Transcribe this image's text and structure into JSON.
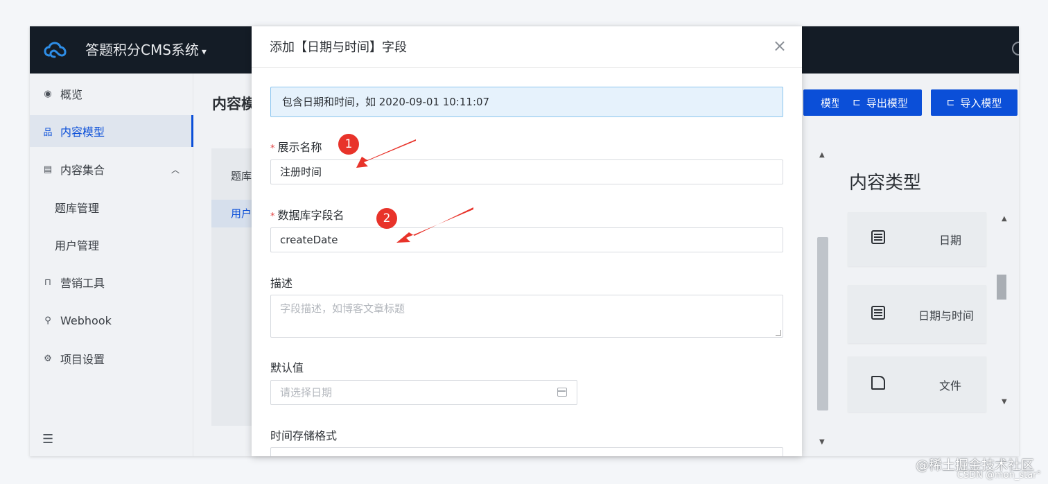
{
  "app": {
    "title": "答题积分CMS系统",
    "caret": "▾"
  },
  "sidebar": {
    "items": [
      {
        "label": "概览",
        "icon": "eye-icon",
        "glyph": "◉"
      },
      {
        "label": "内容模型",
        "icon": "org-chart-icon",
        "glyph": "品",
        "active": true
      },
      {
        "label": "内容集合",
        "icon": "collection-icon",
        "glyph": "▤",
        "chevron": "︿"
      },
      {
        "label": "题库管理",
        "sub": true
      },
      {
        "label": "用户管理",
        "sub": true
      },
      {
        "label": "营销工具",
        "icon": "shopping-bag-icon",
        "glyph": "⊓"
      },
      {
        "label": "Webhook",
        "icon": "webhook-icon",
        "glyph": "⚲"
      },
      {
        "label": "项目设置",
        "icon": "gear-icon",
        "glyph": "⚙"
      }
    ],
    "collapse_glyph": "☰"
  },
  "main": {
    "page_title": "内容模",
    "buttons": [
      {
        "label": "模型",
        "icon": ""
      },
      {
        "label": "导出模型",
        "icon": "⊏"
      },
      {
        "label": "导入模型",
        "icon": "⊏"
      }
    ],
    "left_rows": [
      "题库",
      "用户"
    ],
    "types_title": "内容类型",
    "types": [
      {
        "label": "日期",
        "icon": "calendar-icon"
      },
      {
        "label": "日期与时间",
        "icon": "calendar-icon"
      },
      {
        "label": "文件",
        "icon": "file-icon"
      }
    ]
  },
  "dialog": {
    "title": "添加【日期与时间】字段",
    "close": "×",
    "tip": "包含日期和时间，如 2020-09-01 10:11:07",
    "fields": {
      "display_name": {
        "label": "展示名称",
        "required": "*",
        "value": "注册时间"
      },
      "db_field": {
        "label": "数据库字段名",
        "required": "*",
        "value": "createDate"
      },
      "description": {
        "label": "描述",
        "placeholder": "字段描述，如博客文章标题"
      },
      "default_value": {
        "label": "默认值",
        "placeholder": "请选择日期"
      },
      "storage_format": {
        "label": "时间存储格式"
      }
    }
  },
  "annotations": {
    "marker1": "1",
    "marker2": "2",
    "color": "#e8332a"
  },
  "watermark": {
    "line1": "@稀土掘金技术社区",
    "line2": "CSDN @mon_star°"
  }
}
